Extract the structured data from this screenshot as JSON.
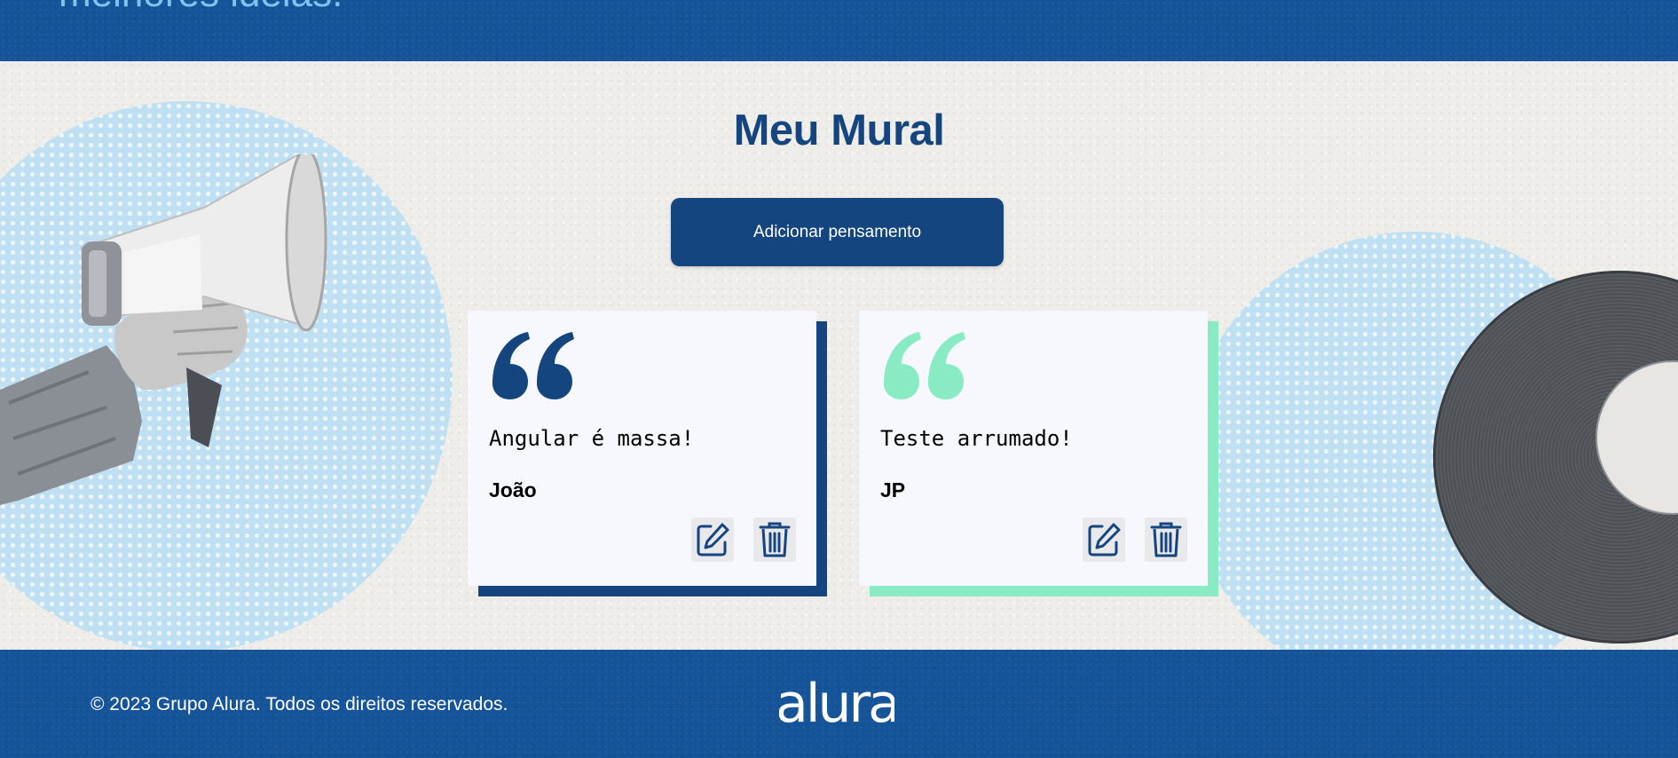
{
  "header": {
    "tagline": "melhores ideias."
  },
  "main": {
    "title": "Meu Mural",
    "add_button_label": "Adicionar pensamento"
  },
  "cards": [
    {
      "text": "Angular é massa!",
      "author": "João",
      "accent_color": "#15457E"
    },
    {
      "text": "Teste arrumado!",
      "author": "JP",
      "accent_color": "#88EBC3"
    }
  ],
  "footer": {
    "copyright": "© 2023 Grupo Alura. Todos os direitos reservados.",
    "logo_text": "alura"
  },
  "colors": {
    "brand_blue": "#155499",
    "dark_blue": "#15457E",
    "mint": "#88EBC3",
    "light_blue": "#BFE0F3"
  },
  "icons": [
    "quote-icon",
    "edit-icon",
    "trash-icon",
    "megaphone-icon",
    "vinyl-record-icon",
    "alura-logo"
  ]
}
